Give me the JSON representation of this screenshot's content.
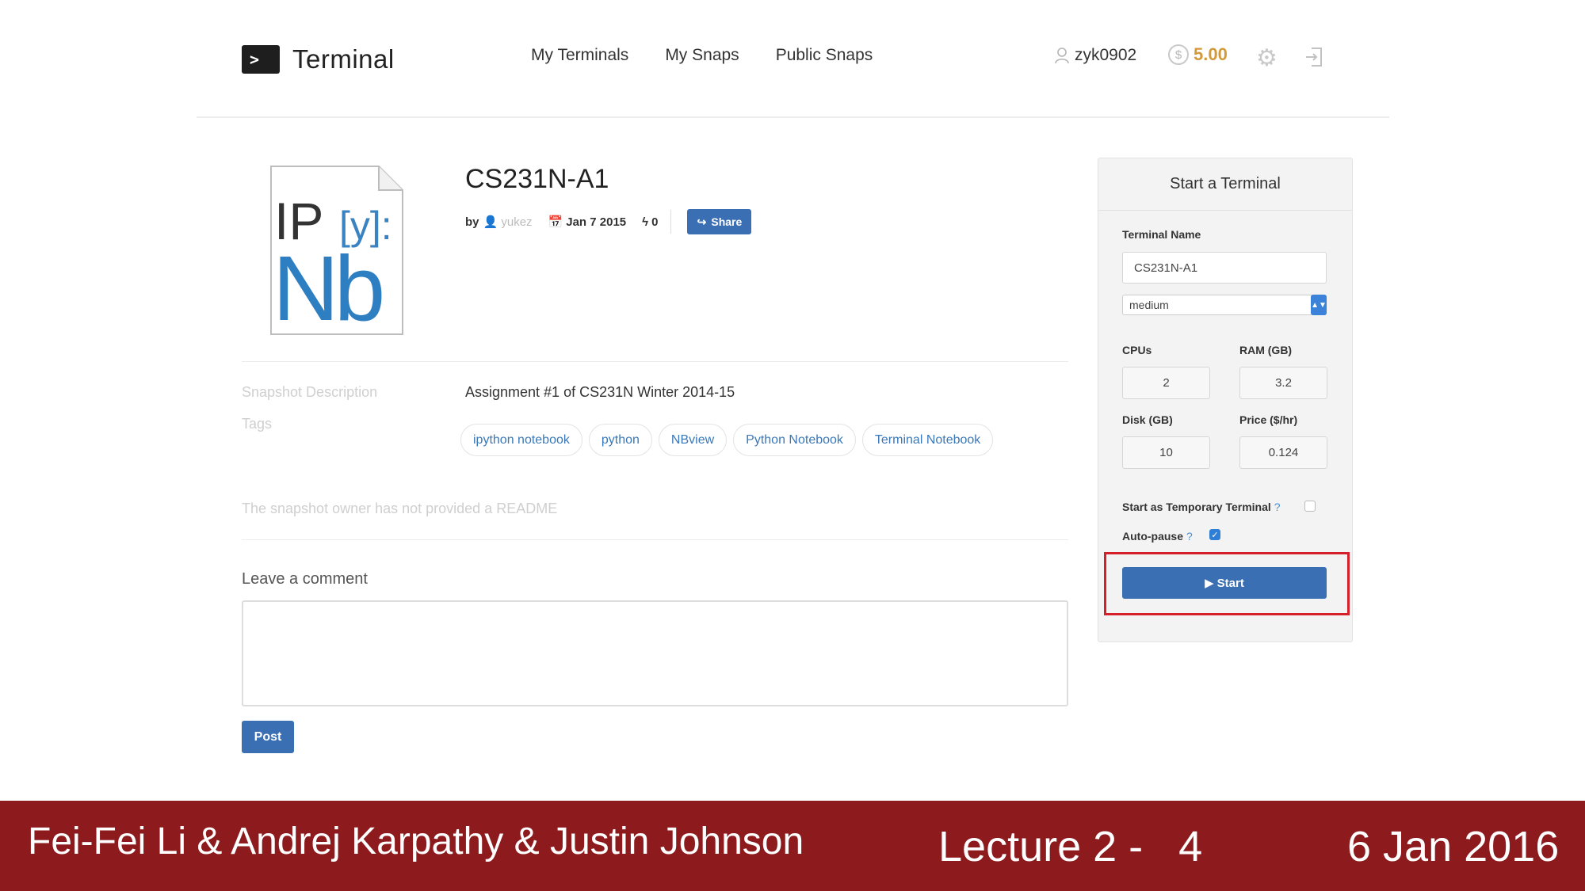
{
  "header": {
    "logo_glyph": ">",
    "logo_text": "Terminal",
    "nav": [
      "My Terminals",
      "My Snaps",
      "Public Snaps"
    ],
    "username": "zyk0902",
    "credit_symbol": "$",
    "credits": "5.00"
  },
  "snapshot": {
    "title": "CS231N-A1",
    "by_label": "by",
    "author": "yukez",
    "date": "Jan 7 2015",
    "bolt_count": "0",
    "share_label": "Share",
    "description_label": "Snapshot Description",
    "description": "Assignment #1 of CS231N Winter 2014-15",
    "tags_label": "Tags",
    "tags": [
      "ipython notebook",
      "python",
      "NBview",
      "Python Notebook",
      "Terminal Notebook"
    ],
    "readme_note": "The snapshot owner has not provided a README",
    "comment_label": "Leave a comment",
    "comment_value": "",
    "post_label": "Post"
  },
  "panel": {
    "title": "Start a Terminal",
    "terminal_name_label": "Terminal Name",
    "terminal_name_value": "CS231N-A1",
    "size_selected": "medium",
    "cpus_label": "CPUs",
    "cpus_value": "2",
    "ram_label": "RAM (GB)",
    "ram_value": "3.2",
    "disk_label": "Disk (GB)",
    "disk_value": "10",
    "price_label": "Price ($/hr)",
    "price_value": "0.124",
    "temporary_label": "Start as Temporary Terminal",
    "temporary_checked": false,
    "autopause_label": "Auto-pause",
    "autopause_checked": true,
    "help_mark": "?",
    "start_label": "Start",
    "highlight_color": "#d3202b"
  },
  "footer": {
    "authors": "Fei-Fei Li & Andrej Karpathy & Justin Johnson",
    "lecture": "Lecture 2 -   4",
    "date": "6 Jan 2016",
    "bar_color": "#8d1b1d"
  },
  "colors": {
    "primary_button": "#3b6fb4",
    "credits": "#d29a3c",
    "tag_text": "#3a78b8"
  }
}
